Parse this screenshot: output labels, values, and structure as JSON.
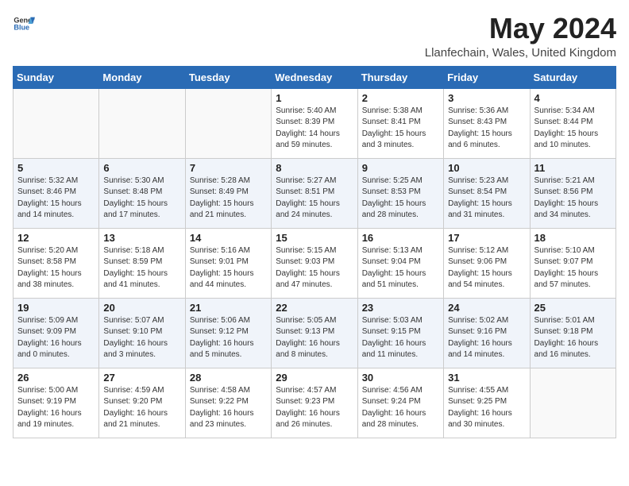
{
  "header": {
    "logo_general": "General",
    "logo_blue": "Blue",
    "month_year": "May 2024",
    "location": "Llanfechain, Wales, United Kingdom"
  },
  "days_of_week": [
    "Sunday",
    "Monday",
    "Tuesday",
    "Wednesday",
    "Thursday",
    "Friday",
    "Saturday"
  ],
  "weeks": [
    [
      {
        "day": "",
        "info": ""
      },
      {
        "day": "",
        "info": ""
      },
      {
        "day": "",
        "info": ""
      },
      {
        "day": "1",
        "info": "Sunrise: 5:40 AM\nSunset: 8:39 PM\nDaylight: 14 hours\nand 59 minutes."
      },
      {
        "day": "2",
        "info": "Sunrise: 5:38 AM\nSunset: 8:41 PM\nDaylight: 15 hours\nand 3 minutes."
      },
      {
        "day": "3",
        "info": "Sunrise: 5:36 AM\nSunset: 8:43 PM\nDaylight: 15 hours\nand 6 minutes."
      },
      {
        "day": "4",
        "info": "Sunrise: 5:34 AM\nSunset: 8:44 PM\nDaylight: 15 hours\nand 10 minutes."
      }
    ],
    [
      {
        "day": "5",
        "info": "Sunrise: 5:32 AM\nSunset: 8:46 PM\nDaylight: 15 hours\nand 14 minutes."
      },
      {
        "day": "6",
        "info": "Sunrise: 5:30 AM\nSunset: 8:48 PM\nDaylight: 15 hours\nand 17 minutes."
      },
      {
        "day": "7",
        "info": "Sunrise: 5:28 AM\nSunset: 8:49 PM\nDaylight: 15 hours\nand 21 minutes."
      },
      {
        "day": "8",
        "info": "Sunrise: 5:27 AM\nSunset: 8:51 PM\nDaylight: 15 hours\nand 24 minutes."
      },
      {
        "day": "9",
        "info": "Sunrise: 5:25 AM\nSunset: 8:53 PM\nDaylight: 15 hours\nand 28 minutes."
      },
      {
        "day": "10",
        "info": "Sunrise: 5:23 AM\nSunset: 8:54 PM\nDaylight: 15 hours\nand 31 minutes."
      },
      {
        "day": "11",
        "info": "Sunrise: 5:21 AM\nSunset: 8:56 PM\nDaylight: 15 hours\nand 34 minutes."
      }
    ],
    [
      {
        "day": "12",
        "info": "Sunrise: 5:20 AM\nSunset: 8:58 PM\nDaylight: 15 hours\nand 38 minutes."
      },
      {
        "day": "13",
        "info": "Sunrise: 5:18 AM\nSunset: 8:59 PM\nDaylight: 15 hours\nand 41 minutes."
      },
      {
        "day": "14",
        "info": "Sunrise: 5:16 AM\nSunset: 9:01 PM\nDaylight: 15 hours\nand 44 minutes."
      },
      {
        "day": "15",
        "info": "Sunrise: 5:15 AM\nSunset: 9:03 PM\nDaylight: 15 hours\nand 47 minutes."
      },
      {
        "day": "16",
        "info": "Sunrise: 5:13 AM\nSunset: 9:04 PM\nDaylight: 15 hours\nand 51 minutes."
      },
      {
        "day": "17",
        "info": "Sunrise: 5:12 AM\nSunset: 9:06 PM\nDaylight: 15 hours\nand 54 minutes."
      },
      {
        "day": "18",
        "info": "Sunrise: 5:10 AM\nSunset: 9:07 PM\nDaylight: 15 hours\nand 57 minutes."
      }
    ],
    [
      {
        "day": "19",
        "info": "Sunrise: 5:09 AM\nSunset: 9:09 PM\nDaylight: 16 hours\nand 0 minutes."
      },
      {
        "day": "20",
        "info": "Sunrise: 5:07 AM\nSunset: 9:10 PM\nDaylight: 16 hours\nand 3 minutes."
      },
      {
        "day": "21",
        "info": "Sunrise: 5:06 AM\nSunset: 9:12 PM\nDaylight: 16 hours\nand 5 minutes."
      },
      {
        "day": "22",
        "info": "Sunrise: 5:05 AM\nSunset: 9:13 PM\nDaylight: 16 hours\nand 8 minutes."
      },
      {
        "day": "23",
        "info": "Sunrise: 5:03 AM\nSunset: 9:15 PM\nDaylight: 16 hours\nand 11 minutes."
      },
      {
        "day": "24",
        "info": "Sunrise: 5:02 AM\nSunset: 9:16 PM\nDaylight: 16 hours\nand 14 minutes."
      },
      {
        "day": "25",
        "info": "Sunrise: 5:01 AM\nSunset: 9:18 PM\nDaylight: 16 hours\nand 16 minutes."
      }
    ],
    [
      {
        "day": "26",
        "info": "Sunrise: 5:00 AM\nSunset: 9:19 PM\nDaylight: 16 hours\nand 19 minutes."
      },
      {
        "day": "27",
        "info": "Sunrise: 4:59 AM\nSunset: 9:20 PM\nDaylight: 16 hours\nand 21 minutes."
      },
      {
        "day": "28",
        "info": "Sunrise: 4:58 AM\nSunset: 9:22 PM\nDaylight: 16 hours\nand 23 minutes."
      },
      {
        "day": "29",
        "info": "Sunrise: 4:57 AM\nSunset: 9:23 PM\nDaylight: 16 hours\nand 26 minutes."
      },
      {
        "day": "30",
        "info": "Sunrise: 4:56 AM\nSunset: 9:24 PM\nDaylight: 16 hours\nand 28 minutes."
      },
      {
        "day": "31",
        "info": "Sunrise: 4:55 AM\nSunset: 9:25 PM\nDaylight: 16 hours\nand 30 minutes."
      },
      {
        "day": "",
        "info": ""
      }
    ]
  ]
}
